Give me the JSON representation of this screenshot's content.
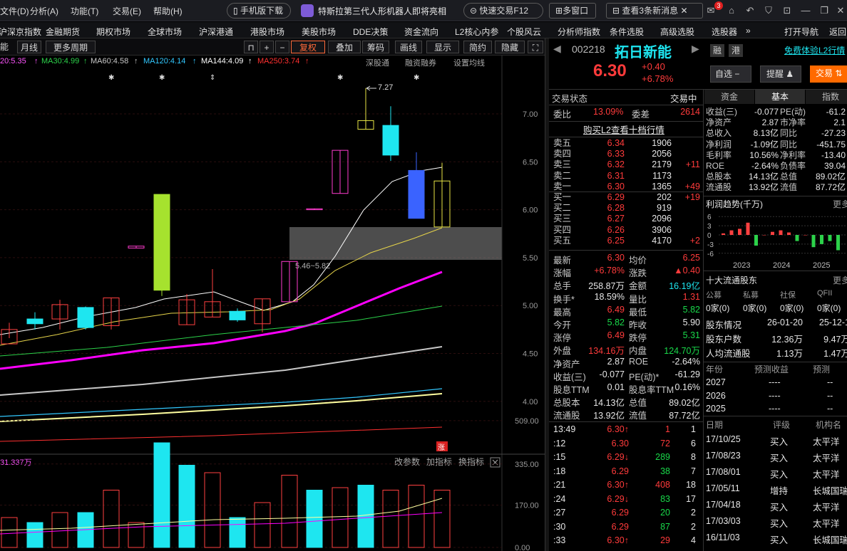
{
  "menu": {
    "items": [
      "文件(D)",
      "分析(A)",
      "功能(T)",
      "交易(E)",
      "帮助(H)"
    ],
    "mobile_btn": "手机版下载",
    "news": "特斯拉第三代人形机器人即将亮相",
    "quick_trade": "快速交易F12",
    "multi_window": "多窗口",
    "news_alert": "查看3条新消息",
    "mail_badge": "3"
  },
  "nav": {
    "items": [
      "沪深京指数",
      "金融期货",
      "期权市场",
      "全球市场",
      "沪深港通",
      "港股市场",
      "美股市场",
      "DDE决策",
      "资金流向",
      "L2核心内参",
      "个股风云",
      "分析师指数",
      "条件选股",
      "高级选股",
      "选股器"
    ],
    "right": [
      "打开导航",
      "返回"
    ]
  },
  "toolbar": {
    "items": [
      "月线",
      "更多周期",
      "复权",
      "叠加",
      "筹码",
      "画线",
      "显示",
      "简约",
      "隐藏"
    ],
    "left_label": "能"
  },
  "ma": {
    "ma20": "20:5.35",
    "ma30": "MA30:4.99",
    "ma60": "MA60:4.58",
    "ma120": "MA120:4.14",
    "ma144": "MA144:4.09",
    "ma250": "MA250:3.74",
    "links": [
      "深股通",
      "融资融券",
      "设置均线"
    ]
  },
  "chart_data": [
    {
      "type": "candlestick",
      "name": "K线",
      "y_ticks": [
        "7.00",
        "6.50",
        "6.00",
        "5.50",
        "5.00",
        "4.50",
        "4.00"
      ],
      "ylim": [
        3.75,
        7.45
      ],
      "candles": [
        {
          "o": 4.75,
          "h": 4.82,
          "l": 4.66,
          "c": 4.6,
          "up": true
        },
        {
          "o": 4.86,
          "h": 4.93,
          "l": 4.75,
          "c": 4.81,
          "up": false
        },
        {
          "o": 4.86,
          "h": 5.06,
          "l": 4.75,
          "c": 5.01,
          "up": true
        },
        {
          "o": 4.98,
          "h": 4.99,
          "l": 4.75,
          "c": 4.77,
          "up": false
        },
        {
          "o": 4.79,
          "h": 5.08,
          "l": 4.75,
          "c": 5.08,
          "up": true
        },
        {
          "o": 5.6,
          "h": 5.62,
          "l": 5.6,
          "c": 5.62,
          "up": true
        },
        {
          "o": 5.16,
          "h": 6.16,
          "l": 5.1,
          "c": 6.16,
          "up": false,
          "lime": true
        },
        {
          "o": 4.8,
          "h": 5.12,
          "l": 4.8,
          "c": 5.06,
          "up": true
        },
        {
          "o": 4.88,
          "h": 5.38,
          "l": 4.88,
          "c": 5.04,
          "up": true
        },
        {
          "o": 4.94,
          "h": 4.97,
          "l": 4.83,
          "c": 4.85,
          "up": false
        },
        {
          "o": 4.81,
          "h": 5.07,
          "l": 4.72,
          "c": 5.07,
          "up": true
        },
        {
          "o": 5.04,
          "h": 5.46,
          "l": 5.04,
          "c": 5.46,
          "up": true
        },
        {
          "o": 6.0,
          "h": 6.01,
          "l": 6.0,
          "c": 6.01,
          "up": true
        },
        {
          "o": 6.17,
          "h": 6.62,
          "l": 6.17,
          "c": 6.62,
          "up": true
        },
        {
          "o": 6.84,
          "h": 7.27,
          "l": 6.84,
          "c": 6.93,
          "up": true
        },
        {
          "o": 6.88,
          "h": 7.08,
          "l": 6.51,
          "c": 6.57,
          "up": false
        },
        {
          "o": 6.41,
          "h": 6.6,
          "l": 5.91,
          "c": 5.91,
          "up": false,
          "blue": true
        },
        {
          "o": 5.82,
          "h": 6.49,
          "l": 5.82,
          "c": 6.3,
          "up": true
        }
      ],
      "high_label": "7.27",
      "zone_label": "5.46~5.82",
      "marker": "涨"
    },
    {
      "type": "bar",
      "name": "成交量",
      "title": "31.337万",
      "links": [
        "改参数",
        "加指标",
        "换指标"
      ],
      "y_ticks": [
        "509.00",
        "335.00",
        "170.00",
        "0.00"
      ],
      "values": [
        120,
        100,
        140,
        140,
        230,
        100,
        420,
        330,
        300,
        120,
        180,
        290,
        230,
        240,
        250,
        230,
        250,
        230,
        490,
        390,
        330,
        290
      ],
      "hollow": [
        true,
        false,
        true,
        false,
        true,
        true,
        false,
        false,
        true,
        false,
        true,
        true,
        false,
        true,
        false,
        true,
        true,
        true,
        true,
        false,
        false,
        true
      ]
    }
  ],
  "stock": {
    "code": "002218",
    "name": "拓日新能",
    "price": "6.30",
    "change": "+0.40",
    "pct": "+6.78%",
    "tags": [
      "融",
      "港"
    ],
    "promo": "免费体验L2行情",
    "btn_watch": "自选",
    "btn_alert": "提醒",
    "btn_trade": "交易",
    "trade_status_label": "交易状态",
    "trade_status": "交易中",
    "wb_label": "委比",
    "wb": "13.09%",
    "wc_label": "委差",
    "wc": "2614",
    "l2_link": "购买L2查看十档行情",
    "asks": [
      {
        "l": "卖五",
        "p": "6.34",
        "v": "1906",
        "d": ""
      },
      {
        "l": "卖四",
        "p": "6.33",
        "v": "2056",
        "d": ""
      },
      {
        "l": "卖三",
        "p": "6.32",
        "v": "2179",
        "d": "+11"
      },
      {
        "l": "卖二",
        "p": "6.31",
        "v": "1173",
        "d": ""
      },
      {
        "l": "卖一",
        "p": "6.30",
        "v": "1365",
        "d": "+49"
      }
    ],
    "bids": [
      {
        "l": "买一",
        "p": "6.29",
        "v": "202",
        "d": "+19"
      },
      {
        "l": "买二",
        "p": "6.28",
        "v": "919",
        "d": ""
      },
      {
        "l": "买三",
        "p": "6.27",
        "v": "2096",
        "d": ""
      },
      {
        "l": "买四",
        "p": "6.26",
        "v": "3906",
        "d": ""
      },
      {
        "l": "买五",
        "p": "6.25",
        "v": "4170",
        "d": "+2"
      }
    ],
    "quotes": [
      [
        "最新",
        "6.30",
        "red",
        "均价",
        "6.25",
        "red"
      ],
      [
        "涨幅",
        "+6.78%",
        "red",
        "涨跌",
        "▲0.40",
        "red"
      ],
      [
        "总手",
        "258.87万",
        "wht",
        "金额",
        "16.19亿",
        "cy"
      ],
      [
        "换手*",
        "18.59%",
        "wht",
        "量比",
        "1.31",
        "red"
      ],
      [
        "最高",
        "6.49",
        "red",
        "最低",
        "5.82",
        "grn"
      ],
      [
        "今开",
        "5.82",
        "grn",
        "昨收",
        "5.90",
        "wht"
      ],
      [
        "涨停",
        "6.49",
        "red",
        "跌停",
        "5.31",
        "grn"
      ],
      [
        "外盘",
        "134.16万",
        "red",
        "内盘",
        "124.70万",
        "grn"
      ],
      [
        "净资产",
        "2.87",
        "wht",
        "ROE",
        "-2.64%",
        "wht"
      ],
      [
        "收益(三)",
        "-0.077",
        "wht",
        "PE(动)*",
        "-61.29",
        "wht"
      ],
      [
        "股息TTM",
        "0.01",
        "wht",
        "股息率TTM",
        "0.16%",
        "wht"
      ],
      [
        "总股本",
        "14.13亿",
        "wht",
        "总值",
        "89.02亿",
        "wht"
      ],
      [
        "流通股",
        "13.92亿",
        "wht",
        "流值",
        "87.72亿",
        "wht"
      ]
    ],
    "ticks": [
      [
        "13:49",
        "6.30↑",
        "red",
        "1",
        "red",
        "1"
      ],
      [
        ":12",
        "6.30",
        "red",
        "72",
        "red",
        "6"
      ],
      [
        ":15",
        "6.29↓",
        "red",
        "289",
        "grn",
        "8"
      ],
      [
        ":18",
        "6.29",
        "red",
        "38",
        "grn",
        "7"
      ],
      [
        ":21",
        "6.30↑",
        "red",
        "408",
        "red",
        "18"
      ],
      [
        ":24",
        "6.29↓",
        "red",
        "83",
        "grn",
        "17"
      ],
      [
        ":27",
        "6.29",
        "red",
        "20",
        "grn",
        "2"
      ],
      [
        ":30",
        "6.29",
        "red",
        "87",
        "grn",
        "2"
      ],
      [
        ":33",
        "6.30↑",
        "red",
        "29",
        "red",
        "4"
      ]
    ],
    "tabs": [
      "资金",
      "基本",
      "指数"
    ],
    "basics": [
      [
        "收益(三)",
        "-0.077",
        "PE(动)",
        "-61.2"
      ],
      [
        "净资产",
        "2.87",
        "市净率",
        "2.1"
      ],
      [
        "总收入",
        "8.13亿",
        "同比",
        "-27.23"
      ],
      [
        "净利润",
        "-1.09亿",
        "同比",
        "-451.75"
      ],
      [
        "毛利率",
        "10.56%",
        "净利率",
        "-13.40"
      ],
      [
        "ROE",
        "-2.64%",
        "负债率",
        "39.04"
      ],
      [
        "总股本",
        "14.13亿",
        "总值",
        "89.02亿"
      ],
      [
        "流通股",
        "13.92亿",
        "流值",
        "87.72亿"
      ]
    ],
    "profit_title": "利润趋势(千万)",
    "more": "更多",
    "profit_chart": {
      "type": "bar",
      "x_labels": [
        "2023",
        "2024",
        "2025"
      ],
      "y_ticks": [
        "6",
        "3",
        "0",
        "-3",
        "-6"
      ],
      "values": [
        0.5,
        1.5,
        2.0,
        4.0,
        -3.5,
        0,
        1.0,
        1.5,
        0.8,
        -2.0,
        0,
        -4.0,
        -3.0,
        -2.0,
        -5.0
      ]
    },
    "holders_title": "十大流通股东",
    "holder_cols": [
      "公募",
      "私募",
      "社保",
      "QFII"
    ],
    "holder_vals": [
      "0家(0)",
      "0家(0)",
      "0家(0)",
      "0家(0)"
    ],
    "holder_info": [
      [
        "股东情况",
        "26-01-20",
        "25-12-1"
      ],
      [
        "股东户数",
        "12.36万",
        "9.47万"
      ],
      [
        "人均流通股",
        "1.13万",
        "1.47万"
      ]
    ],
    "forecast_cols": [
      "年份",
      "预测收益",
      "预测"
    ],
    "forecast": [
      [
        "2027",
        "----",
        "--"
      ],
      [
        "2026",
        "----",
        "--"
      ],
      [
        "2025",
        "----",
        "--"
      ]
    ],
    "rating_cols": [
      "日期",
      "评级",
      "机构名"
    ],
    "ratings": [
      [
        "17/10/25",
        "买入",
        "太平洋"
      ],
      [
        "17/08/23",
        "买入",
        "太平洋"
      ],
      [
        "17/08/01",
        "买入",
        "太平洋"
      ],
      [
        "17/05/11",
        "增持",
        "长城国瑞"
      ],
      [
        "17/04/18",
        "买入",
        "太平洋"
      ],
      [
        "17/03/03",
        "买入",
        "太平洋"
      ],
      [
        "16/11/03",
        "买入",
        "长城国瑞"
      ]
    ]
  }
}
